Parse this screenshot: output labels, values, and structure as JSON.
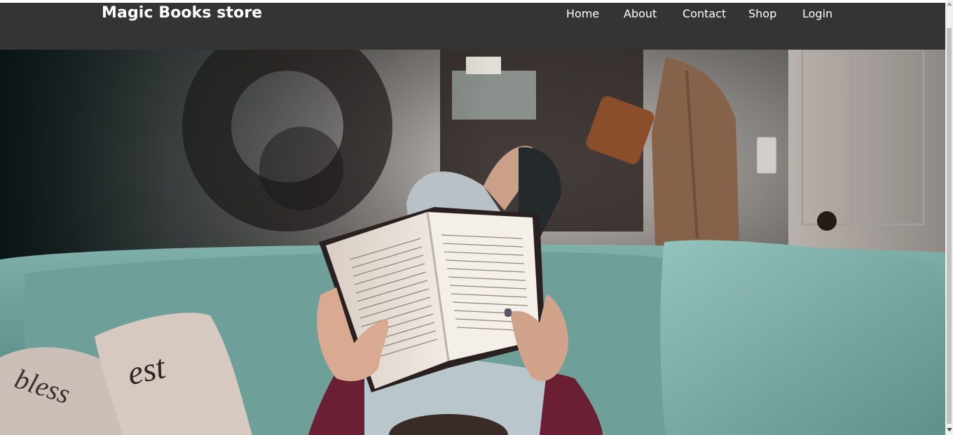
{
  "header": {
    "brand": "Magic Books store",
    "nav": {
      "home": "Home",
      "about": "About",
      "contact": "Contact",
      "shop": "Shop",
      "login": "Login"
    }
  },
  "hero": {
    "image_subject": "person-reading-book-on-couch-photo",
    "pillow_lettering": [
      "bless",
      "est"
    ]
  },
  "colors": {
    "navbar_bg": "#343434",
    "nav_text": "#ffffff",
    "couch": "#6f9e98",
    "wall": "#3a3f3e",
    "sweater": "#6b1f33"
  }
}
